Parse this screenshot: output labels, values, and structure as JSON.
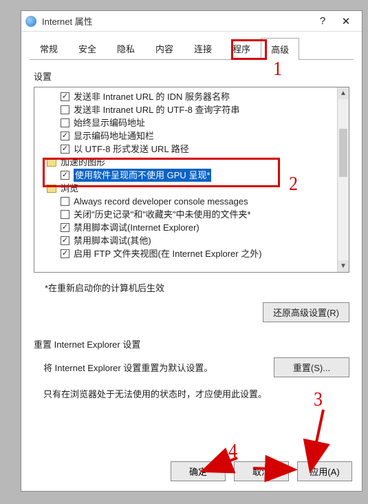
{
  "window": {
    "title": "Internet 属性",
    "help_btn": "?",
    "close_btn": "✕"
  },
  "tabs": [
    "常规",
    "安全",
    "隐私",
    "内容",
    "连接",
    "程序",
    "高级"
  ],
  "active_tab_index": 6,
  "settings_label": "设置",
  "tree": {
    "items": [
      {
        "indent": 2,
        "checked": true,
        "label": "发送非 Intranet URL 的 IDN 服务器名称"
      },
      {
        "indent": 2,
        "checked": false,
        "label": "发送非 Intranet URL 的 UTF-8 查询字符串"
      },
      {
        "indent": 2,
        "checked": false,
        "label": "始终显示编码地址"
      },
      {
        "indent": 2,
        "checked": true,
        "label": "显示编码地址通知栏"
      },
      {
        "indent": 2,
        "checked": true,
        "label": "以 UTF-8 形式发送 URL 路径"
      }
    ],
    "category1": "加速的图形",
    "gpu_item": {
      "checked": true,
      "label": "使用软件呈现而不使用 GPU 呈现*"
    },
    "category2": "浏览",
    "items2": [
      {
        "indent": 2,
        "checked": false,
        "label": "Always record developer console messages"
      },
      {
        "indent": 2,
        "checked": false,
        "label": "关闭\"历史记录\"和\"收藏夹\"中未使用的文件夹*"
      },
      {
        "indent": 2,
        "checked": true,
        "label": "禁用脚本调试(Internet Explorer)"
      },
      {
        "indent": 2,
        "checked": true,
        "label": "禁用脚本调试(其他)"
      },
      {
        "indent": 2,
        "checked": true,
        "label": "启用 FTP 文件夹视图(在 Internet Explorer 之外)"
      }
    ]
  },
  "restart_note": "*在重新启动你的计算机后生效",
  "restore_btn": "还原高级设置(R)",
  "reset_section_label": "重置 Internet Explorer 设置",
  "reset_text": "将 Internet Explorer 设置重置为默认设置。",
  "reset_btn": "重置(S)...",
  "reset_hint": "只有在浏览器处于无法使用的状态时，才应使用此设置。",
  "bottom": {
    "ok": "确定",
    "cancel": "取消",
    "apply": "应用(A)"
  },
  "annotations": {
    "n1": "1",
    "n2": "2",
    "n3": "3",
    "n4": "4"
  }
}
